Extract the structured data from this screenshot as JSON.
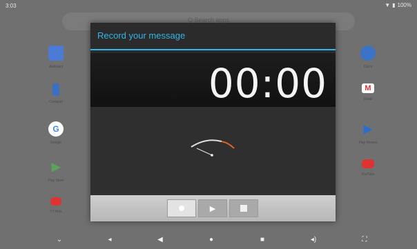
{
  "status": {
    "time": "3:03",
    "battery": "100%"
  },
  "home": {
    "search_placeholder": "Q Search apps",
    "left_apps": [
      {
        "label": "Assistant",
        "icon": "assistant-icon",
        "color": "#4c7bd6"
      },
      {
        "label": "Contacts",
        "icon": "contacts-icon",
        "color": "#3a6fc4"
      },
      {
        "label": "Google",
        "icon": "google-icon",
        "color": "#ffffff"
      },
      {
        "label": "Play Store",
        "icon": "play-store-icon",
        "color": "#5aa55a"
      },
      {
        "label": "YT Kids",
        "icon": "youtube-kids-icon",
        "color": "#d33"
      }
    ],
    "right_apps": [
      {
        "label": "Clock",
        "icon": "clock-icon",
        "color": "#3b73c7"
      },
      {
        "label": "Gmail",
        "icon": "gmail-icon",
        "color": "#ffffff"
      },
      {
        "label": "Play Movies",
        "icon": "play-movies-icon",
        "color": "#2c6fc8"
      },
      {
        "label": "YouTube",
        "icon": "youtube-icon",
        "color": "#d33"
      }
    ]
  },
  "dialog": {
    "title": "Record your message",
    "timer": "00:00",
    "accent": "#33b5e5",
    "buttons": [
      {
        "name": "record-button",
        "icon": "record-icon",
        "active": true
      },
      {
        "name": "play-button",
        "icon": "play-icon",
        "active": false
      },
      {
        "name": "stop-button",
        "icon": "stop-icon",
        "active": false
      }
    ]
  },
  "navbar": {
    "items": [
      "chevron-down-icon",
      "volume-down-icon",
      "back-icon",
      "home-icon",
      "recents-icon",
      "volume-up-icon",
      "screenshot-icon"
    ]
  }
}
